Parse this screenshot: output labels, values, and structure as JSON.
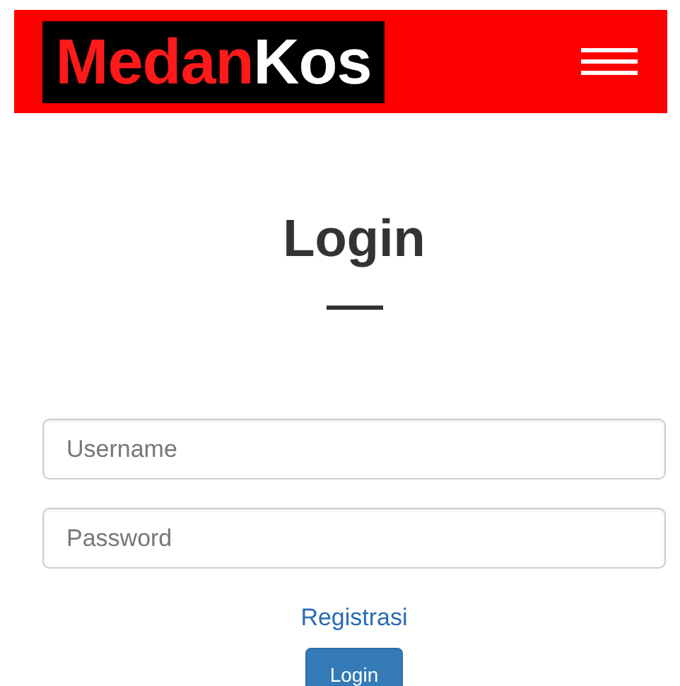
{
  "header": {
    "logo": [
      {
        "text": "Medan",
        "kind": "accent"
      },
      {
        "text": "Kos",
        "kind": "plain"
      }
    ]
  },
  "title": "Login",
  "form": {
    "fields": [
      {
        "placeholder": "Username"
      },
      {
        "placeholder": "Password"
      }
    ],
    "register_link": "Registrasi",
    "submit": "Login"
  }
}
